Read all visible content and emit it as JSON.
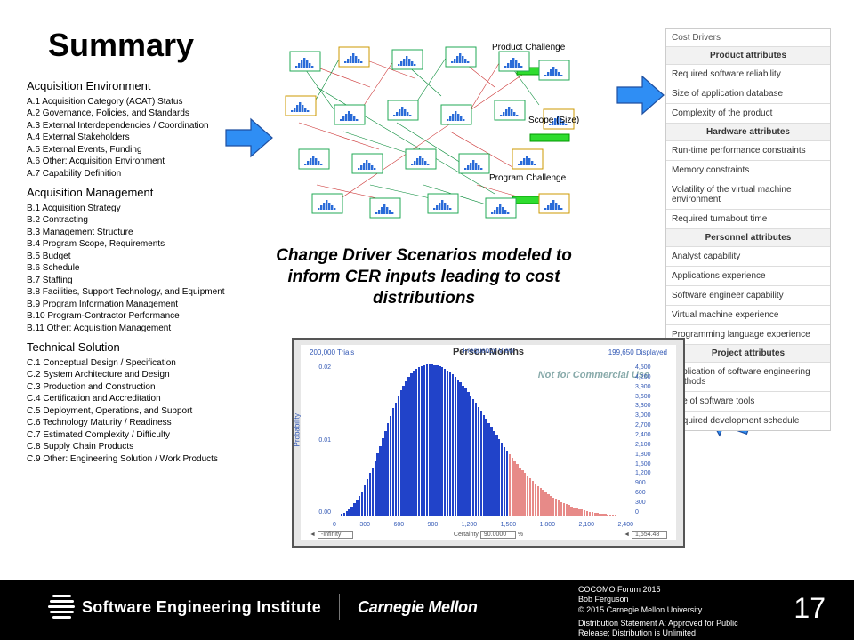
{
  "title": "Summary",
  "left": {
    "groups": [
      {
        "title": "Acquisition Environment",
        "items": [
          "A.1 Acquisition Category (ACAT) Status",
          "A.2 Governance, Policies, and Standards",
          "A.3 External Interdependencies / Coordination",
          "A.4 External Stakeholders",
          "A.5 External Events, Funding",
          "A.6 Other:  Acquisition Environment",
          "A.7 Capability Definition"
        ]
      },
      {
        "title": "Acquisition Management",
        "items": [
          "B.1  Acquisition Strategy",
          "B.2  Contracting",
          "B.3  Management Structure",
          "B.4  Program Scope, Requirements",
          "B.5  Budget",
          "B.6  Schedule",
          "B.7  Staffing",
          "B.8  Facilities, Support Technology, and Equipment",
          "B.9  Program Information Management",
          "B.10 Program-Contractor Performance",
          "B.11 Other: Acquisition Management"
        ]
      },
      {
        "title": "Technical Solution",
        "items": [
          "C.1 Conceptual Design / Specification",
          "C.2 System Architecture and Design",
          "C.3 Production and Construction",
          "C.4 Certification and Accreditation",
          "C.5 Deployment, Operations, and Support",
          "C.6 Technology Maturity / Readiness",
          "C.7 Estimated Complexity / Difficulty",
          "C.8 Supply Chain Products",
          "C.9 Other: Engineering Solution / Work Products"
        ]
      }
    ]
  },
  "net_labels": {
    "l1": "Product Challenge",
    "l2": "Scope (Size)",
    "l3": "Program Challenge"
  },
  "center_msg": "Change Driver Scenarios modeled to inform CER inputs leading to cost distributions",
  "right": {
    "header": "Cost Drivers",
    "groups": [
      {
        "title": "Product attributes",
        "rows": [
          "Required software reliability",
          "Size of application database",
          "Complexity of the product"
        ]
      },
      {
        "title": "Hardware attributes",
        "rows": [
          "Run-time performance constraints",
          "Memory constraints",
          "Volatility of the virtual machine environment",
          "Required turnabout time"
        ]
      },
      {
        "title": "Personnel attributes",
        "rows": [
          "Analyst capability",
          "Applications experience",
          "Software engineer capability",
          "Virtual machine experience",
          "Programming language experience"
        ]
      },
      {
        "title": "Project attributes",
        "rows": [
          "Application of software engineering methods",
          "Use of software tools",
          "Required development schedule"
        ]
      }
    ]
  },
  "chart_data": {
    "type": "bar",
    "title": "Person-Months",
    "view": "Frequency View",
    "trials": "200,000 Trials",
    "displayed": "199,650 Displayed",
    "watermark": "Not for Commercial Use",
    "xlabel": "",
    "ylabel": "Probability",
    "x_ticks": [
      "0",
      "300",
      "600",
      "900",
      "1,200",
      "1,500",
      "1,800",
      "2,100",
      "2,400"
    ],
    "y_ticks_left": [
      "0.02",
      "0.01",
      "0.00"
    ],
    "y_ticks_right": [
      "4,500",
      "4,200",
      "3,900",
      "3,600",
      "3,300",
      "3,000",
      "2,700",
      "2,400",
      "2,100",
      "1,800",
      "1,500",
      "1,200",
      "900",
      "600",
      "300",
      "0"
    ],
    "bottom": {
      "left_arrow": "-Infinity",
      "center_label": "Certainty",
      "center_value": "90.0000",
      "center_unit": "%",
      "right_arrow": "1,654.48"
    },
    "threshold_index": 68,
    "values": [
      0,
      0,
      0,
      1,
      2,
      3,
      4,
      6,
      8,
      10,
      13,
      16,
      20,
      24,
      28,
      32,
      36,
      41,
      46,
      51,
      56,
      61,
      66,
      71,
      75,
      79,
      83,
      86,
      89,
      92,
      94,
      96,
      97,
      98,
      99,
      99.5,
      99.8,
      100,
      100,
      99.7,
      99.3,
      98.7,
      98,
      97,
      96,
      94.8,
      93.3,
      91.7,
      90,
      88,
      86,
      84,
      81.7,
      79.3,
      77,
      74.5,
      72,
      69.3,
      66.7,
      64,
      61.3,
      58.7,
      56,
      53.3,
      50.7,
      48,
      45.5,
      43,
      40.7,
      38.3,
      36,
      34,
      32,
      30,
      28,
      26.2,
      24.5,
      22.8,
      21.2,
      19.7,
      18.2,
      16.8,
      15.5,
      14.2,
      13,
      12,
      11,
      10,
      9.1,
      8.3,
      7.5,
      6.8,
      6.1,
      5.5,
      4.9,
      4.4,
      3.9,
      3.4,
      3,
      2.6,
      2.2,
      1.9,
      1.6,
      1.3,
      1.1,
      0.9,
      0.7,
      0.6,
      0.5,
      0.4,
      0.3,
      0.2,
      0.15,
      0.1,
      0.08,
      0.05
    ]
  },
  "footer": {
    "sei": "Software Engineering Institute",
    "cmu": "Carnegie Mellon",
    "line1": "COCOMO Forum 2015",
    "line2": "Bob Ferguson",
    "line3": "© 2015 Carnegie Mellon University",
    "line4": "Distribution Statement A: Approved for Public Release; Distribution is Unlimited",
    "slide": "17"
  }
}
